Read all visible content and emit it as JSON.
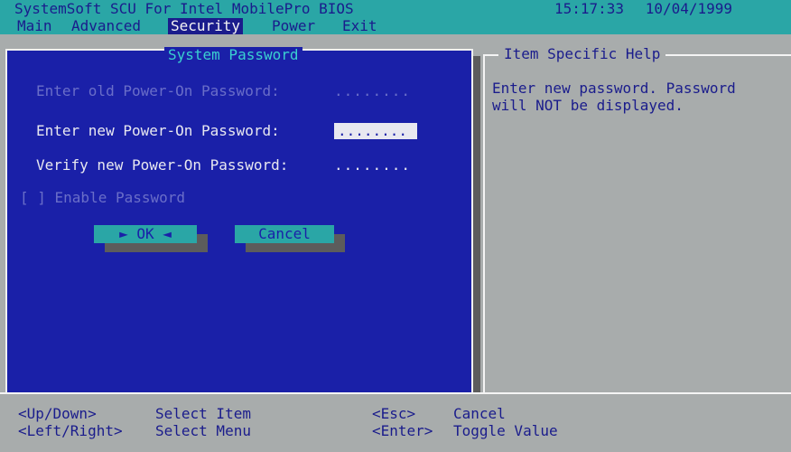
{
  "title_bar": {
    "app_title": "SystemSoft SCU For Intel MobilePro BIOS",
    "time": "15:17:33",
    "date": "10/04/1999"
  },
  "menu": {
    "items": [
      "Main",
      "Advanced",
      "Security",
      "Power",
      "Exit"
    ],
    "active": "Security"
  },
  "dialog": {
    "title": "System Password",
    "old_label": "Enter old Power-On Password:",
    "old_value": "........",
    "new_label": "Enter new Power-On Password:",
    "new_value": "........",
    "verify_label": "Verify new Power-On Password:",
    "verify_value": "........",
    "enable_label": "[ ] Enable Password",
    "ok_label": "►  OK  ◄",
    "cancel_label": "Cancel"
  },
  "help": {
    "title": "Item Specific Help",
    "text": "Enter new password. Password\nwill NOT be displayed."
  },
  "hints": [
    {
      "key": "<Up/Down>",
      "action": "Select Item"
    },
    {
      "key": "<Left/Right>",
      "action": "Select Menu"
    },
    {
      "key": "<Esc>",
      "action": "Cancel"
    },
    {
      "key": "<Enter>",
      "action": "Toggle Value"
    }
  ],
  "colors": {
    "cyan": "#2aa6a6",
    "dialog_blue": "#1a20a8",
    "text_navy": "#1a1c8c",
    "gray": "#a8acac"
  }
}
